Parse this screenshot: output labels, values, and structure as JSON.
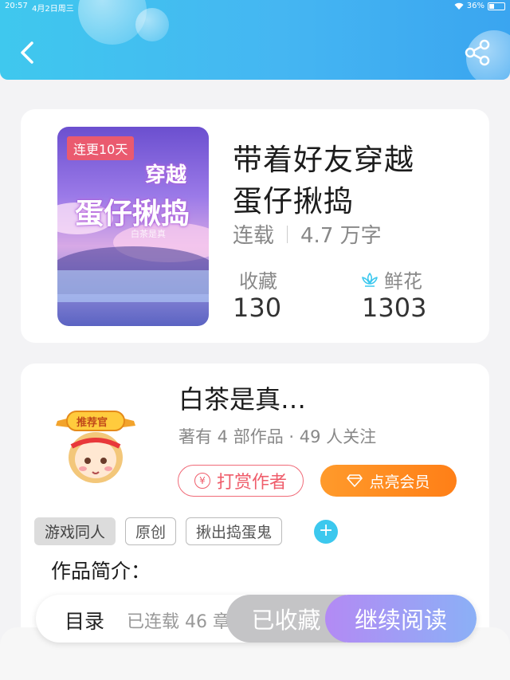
{
  "status_bar": {
    "time": "20:57",
    "date": "4月2日周三",
    "battery": "36%"
  },
  "book": {
    "cover_tag": "连更10天",
    "cover_title_line1": "穿越",
    "cover_title_line2": "蛋仔揪捣",
    "cover_author": "白茶是真",
    "title_line1": "带着好友穿越",
    "title_line2": "蛋仔揪捣",
    "status": "连载",
    "word_count": "4.7 万字",
    "favorites_label": "收藏",
    "favorites_value": "130",
    "flowers_label": "鲜花",
    "flowers_value": "1303"
  },
  "author": {
    "badge": "推荐官",
    "name": "白茶是真…",
    "info": "著有 4 部作品 · 49 人关注",
    "tip_label": "打赏作者",
    "vip_label": "点亮会员"
  },
  "tags": [
    "游戏同人",
    "原创",
    "揪出捣蛋鬼"
  ],
  "intro_label": "作品简介：",
  "bottom_bar": {
    "toc_label": "目录",
    "toc_count": "已连载 46 章",
    "collect_label": "已收藏",
    "read_label": "继续阅读"
  },
  "colors": {
    "header": "#45b6f2",
    "accent": "#3cc8ee",
    "tip": "#ef5d6b",
    "vip": "#ff8a1f"
  }
}
